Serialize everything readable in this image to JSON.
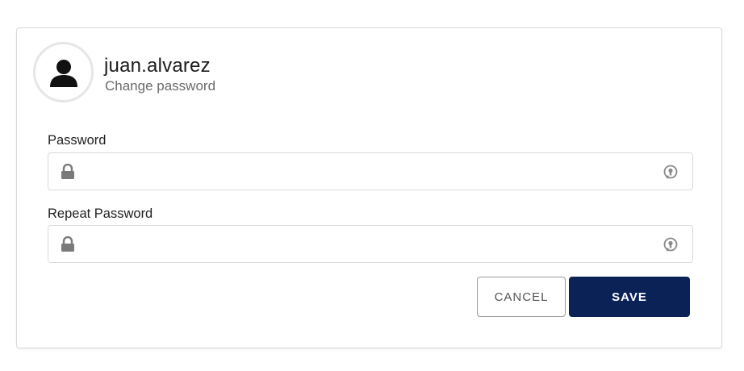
{
  "profile": {
    "username": "juan.alvarez",
    "subtitle": "Change password"
  },
  "fields": [
    {
      "label": "Password",
      "value": "",
      "placeholder": ""
    },
    {
      "label": "Repeat Password",
      "value": "",
      "placeholder": ""
    }
  ],
  "actions": {
    "cancel_label": "CANCEL",
    "save_label": "SAVE"
  },
  "icons": {
    "avatar": "user-icon",
    "lock": "lock-icon",
    "reveal": "eye-reveal-icon"
  },
  "colors": {
    "primary": "#0b2257",
    "border": "#dadada",
    "muted_text": "#6a6a6a",
    "icon": "#777777"
  }
}
